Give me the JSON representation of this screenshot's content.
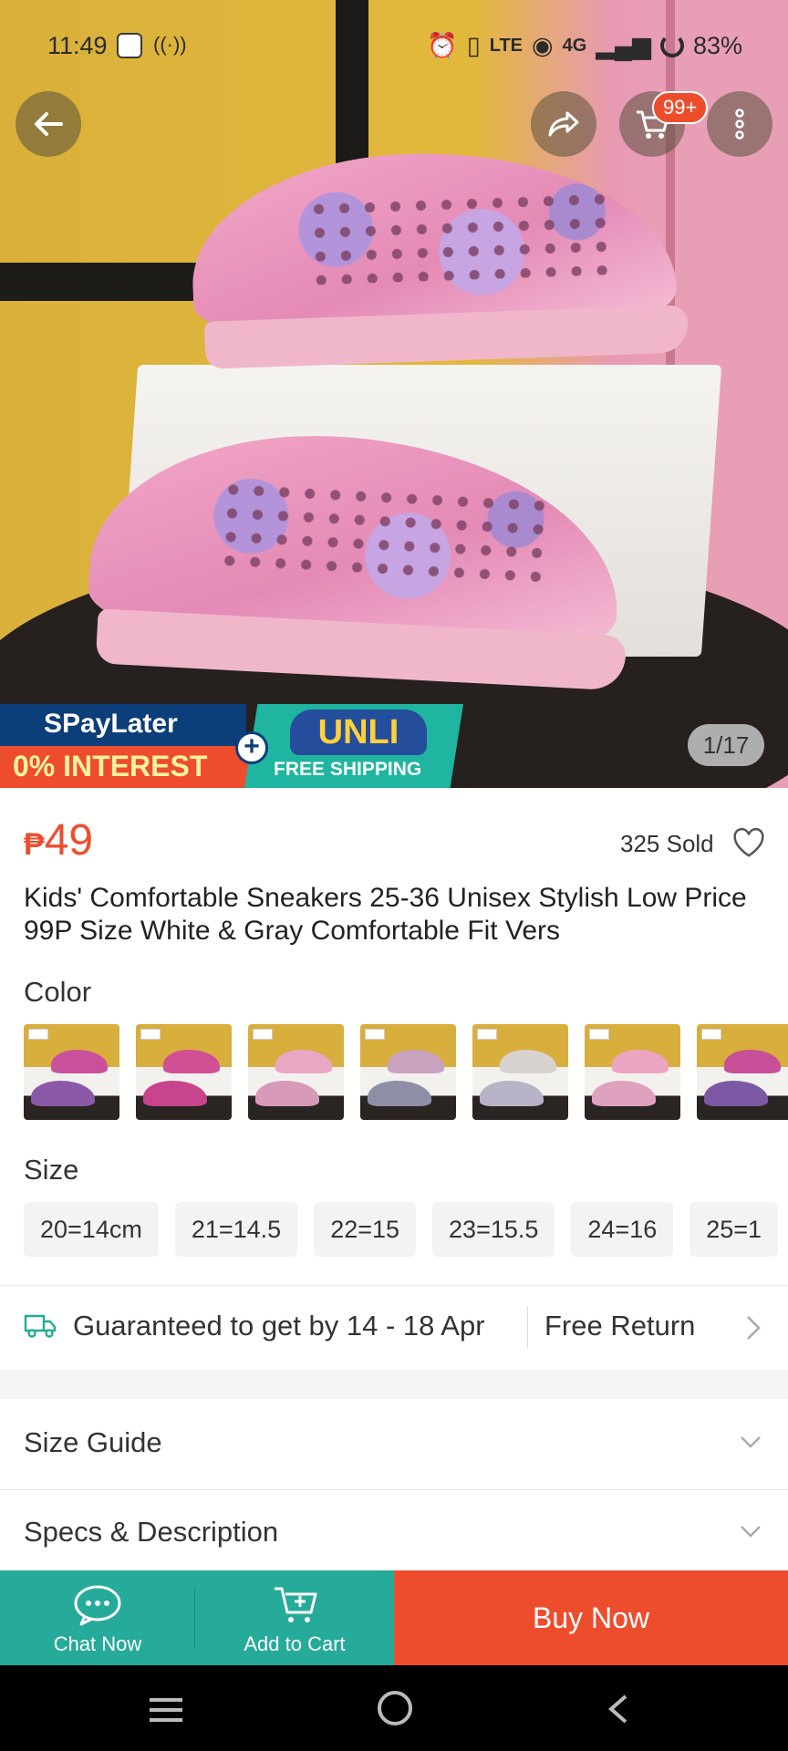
{
  "status_bar": {
    "time": "11:49",
    "network": "4G",
    "battery": "83%"
  },
  "nav": {
    "cart_badge": "99+"
  },
  "image": {
    "counter": "1/17",
    "promo": {
      "spaylater": "SPayLater",
      "interest": "0% INTEREST",
      "unli": "UNLI",
      "free_shipping": "FREE SHIPPING"
    }
  },
  "product": {
    "currency": "₱",
    "price": "49",
    "sold": "325 Sold",
    "title": "Kids' Comfortable Sneakers 25-36 Unisex Stylish Low Price 99P Size White & Gray Comfortable Fit Vers"
  },
  "color_section": {
    "label": "Color",
    "swatches": [
      {
        "top": "#c9509a",
        "bottom": "#8a5aa8"
      },
      {
        "top": "#d14f95",
        "bottom": "#c8448c"
      },
      {
        "top": "#e8a8c4",
        "bottom": "#d79ab8"
      },
      {
        "top": "#c9a2c0",
        "bottom": "#8e8fa6"
      },
      {
        "top": "#d8d2d0",
        "bottom": "#b9b3c8"
      },
      {
        "top": "#eba5c2",
        "bottom": "#dea2bf"
      },
      {
        "top": "#c64f98",
        "bottom": "#7d58a5"
      }
    ]
  },
  "size_section": {
    "label": "Size",
    "options": [
      "20=14cm",
      "21=14.5",
      "22=15",
      "23=15.5",
      "24=16",
      "25=1"
    ]
  },
  "shipping": {
    "guarantee": "Guaranteed to get by 14 - 18 Apr",
    "return": "Free Return"
  },
  "rows": {
    "size_guide": "Size Guide",
    "specs": "Specs & Description"
  },
  "bottom_bar": {
    "chat": "Chat Now",
    "add_to_cart": "Add to Cart",
    "buy_now": "Buy Now"
  },
  "colors": {
    "brand": "#ee4d2d",
    "teal": "#26aa99"
  }
}
